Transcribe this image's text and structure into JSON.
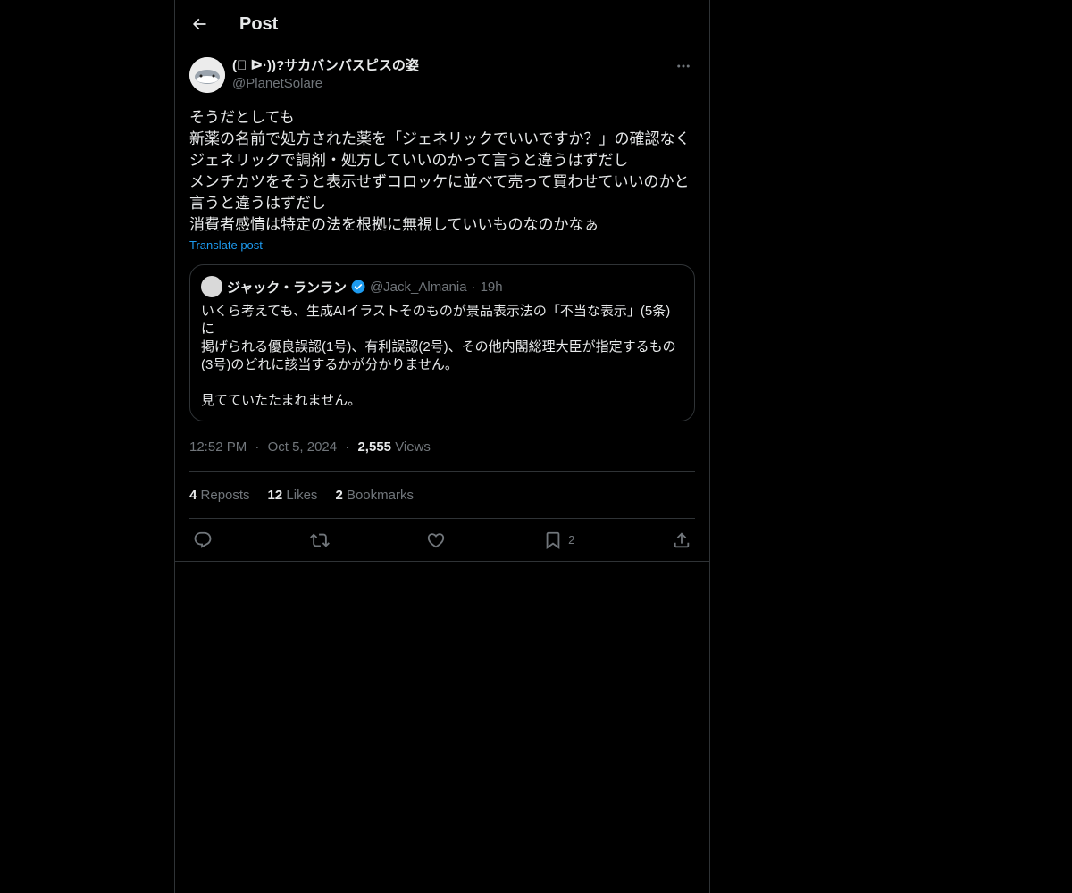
{
  "header": {
    "title": "Post"
  },
  "post": {
    "display_name": "(ﾟ ᐅ·))?サカバンバスピスの姿",
    "handle": "@PlanetSolare",
    "text": "そうだとしても\n新薬の名前で処方された薬を「ジェネリックでいいですか？」の確認なく\nジェネリックで調剤・処方していいのかって言うと違うはずだし\nメンチカツをそうと表示せずコロッケに並べて売って買わせていいのかと\n言うと違うはずだし\n消費者感情は特定の法を根拠に無視していいものなのかなぁ",
    "translate": "Translate post",
    "quote": {
      "name": "ジャック・ランラン",
      "handle": "@Jack_Almania",
      "sep": "·",
      "time": "19h",
      "text": "いくら考えても、生成AIイラストそのものが景品表示法の「不当な表示」(5条)に\n掲げられる優良誤認(1号)、有利誤認(2号)、その他内閣総理大臣が指定するもの\n(3号)のどれに該当するかが分かりません。\n\n見てていたたまれません。"
    },
    "meta": {
      "time": "12:52 PM",
      "sep": "·",
      "date": "Oct 5, 2024",
      "views_count": "2,555",
      "views_label": "Views"
    },
    "stats": {
      "reposts_count": "4",
      "reposts_label": "Reposts",
      "likes_count": "12",
      "likes_label": "Likes",
      "bookmarks_count": "2",
      "bookmarks_label": "Bookmarks"
    },
    "actions": {
      "bookmark_count": "2"
    }
  },
  "colors": {
    "accent": "#1d9bf0",
    "text": "#e7e9ea",
    "muted": "#71767b",
    "border": "#2f3336",
    "background": "#000000"
  },
  "icons": [
    "back-arrow-icon",
    "more-icon",
    "verified-icon",
    "reply-icon",
    "repost-icon",
    "like-icon",
    "bookmark-icon",
    "share-icon"
  ]
}
